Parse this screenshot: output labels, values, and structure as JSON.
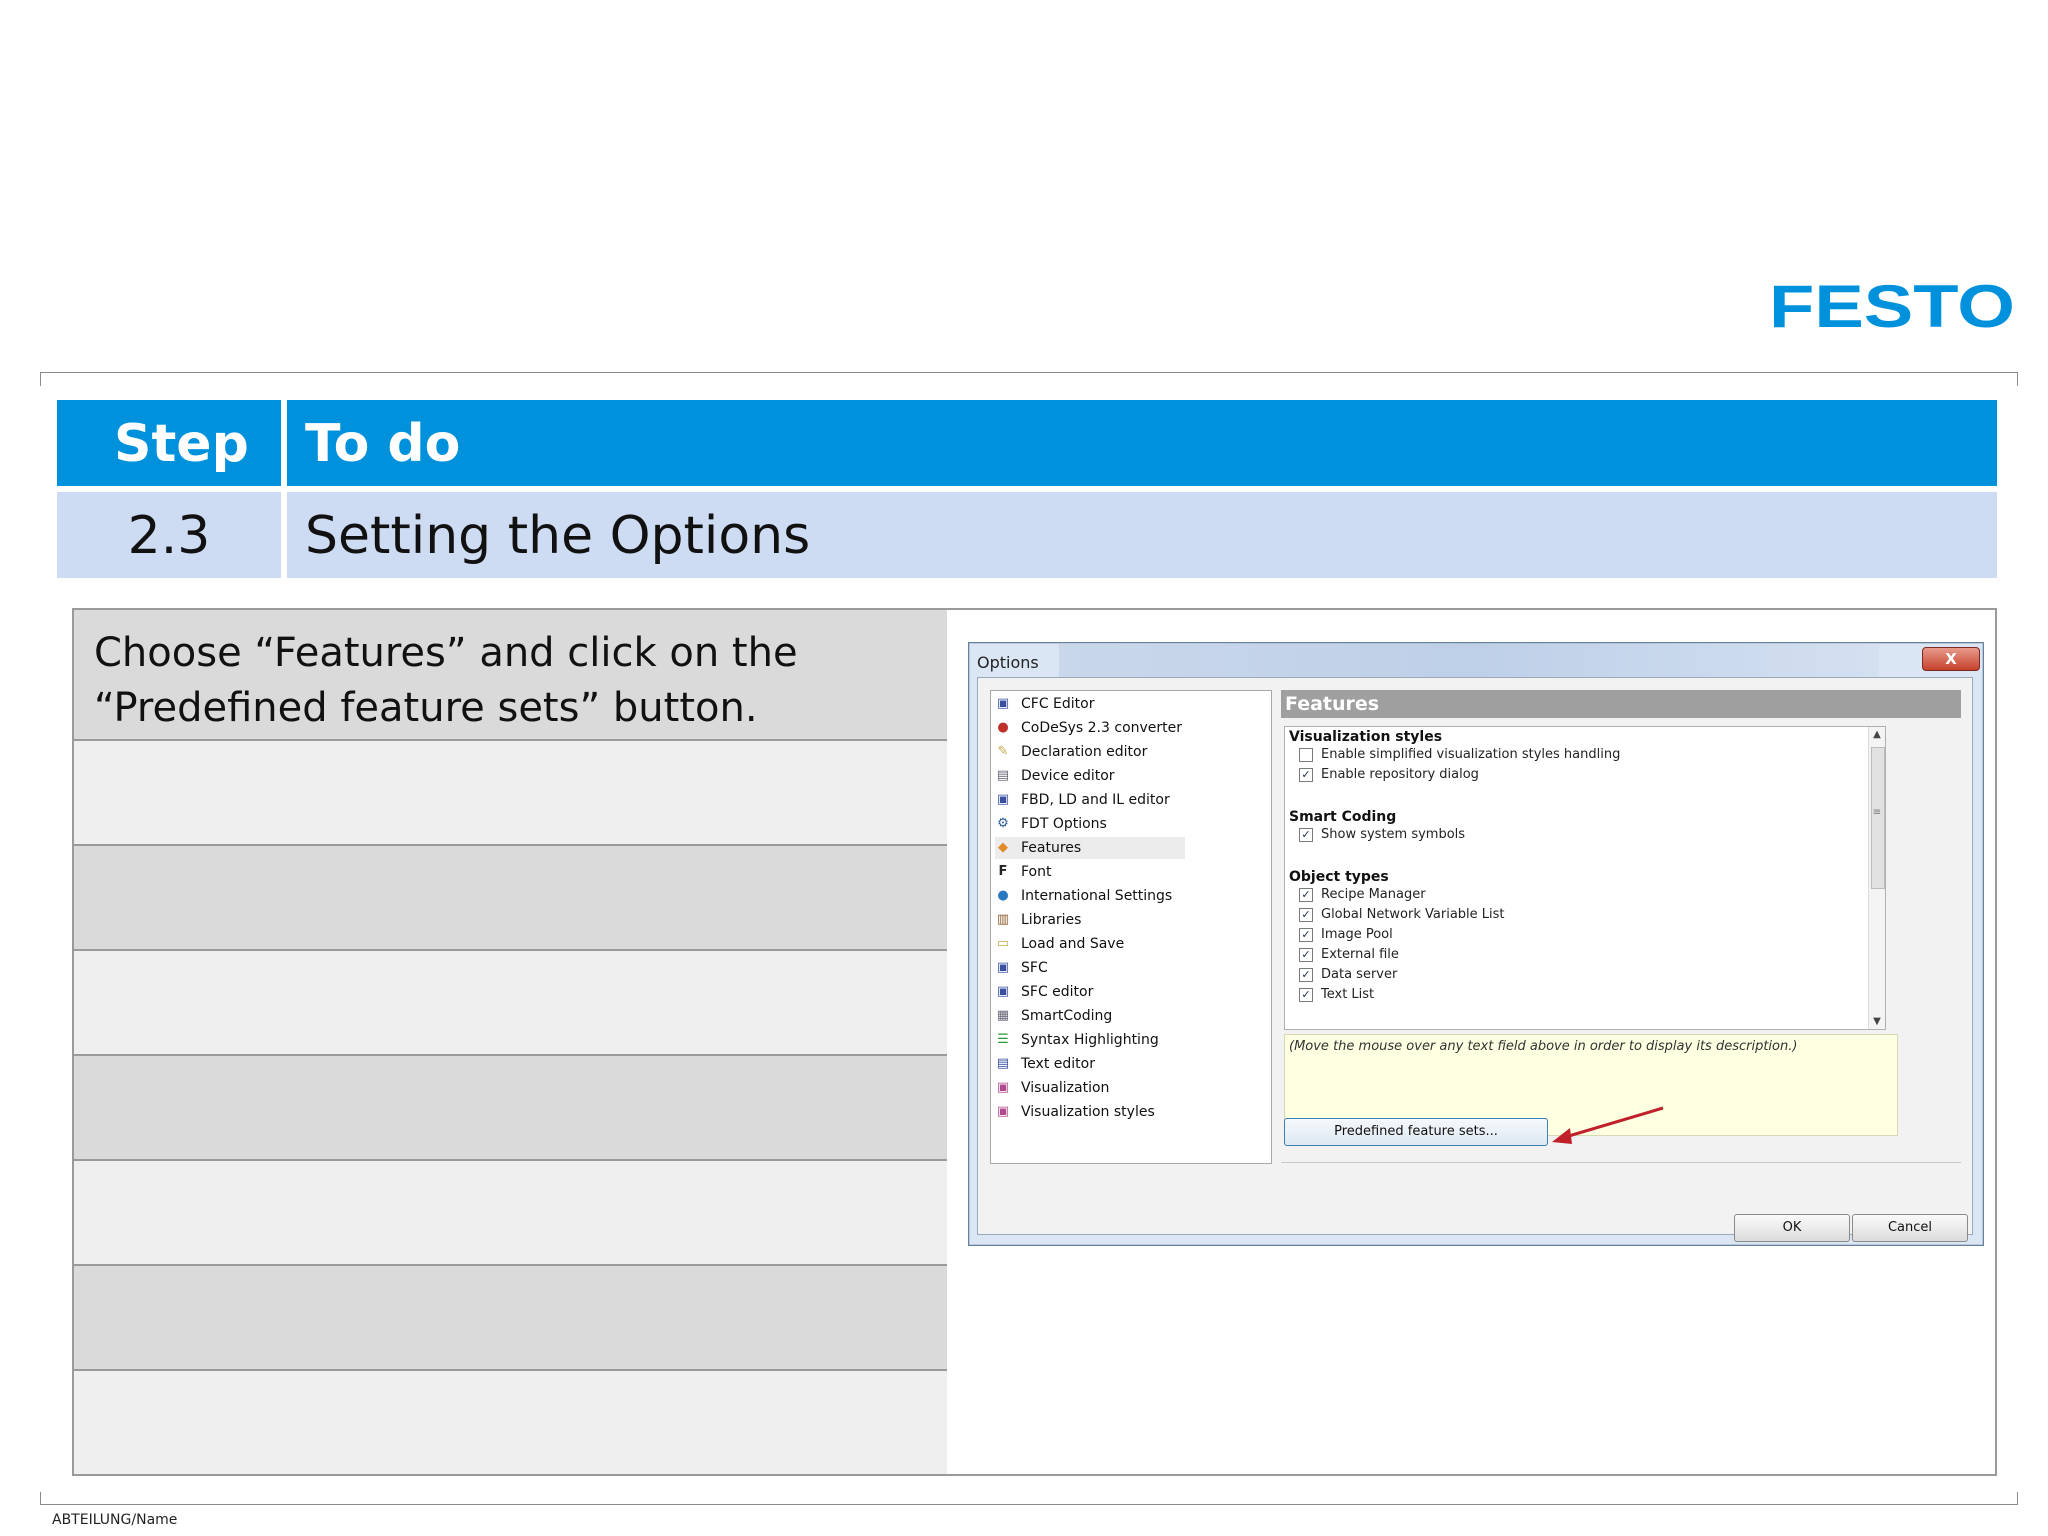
{
  "brand": {
    "logo_text": "FESTO",
    "color": "#0091dc"
  },
  "header": {
    "step_label": "Step",
    "todo_label": "To do"
  },
  "subheader": {
    "step_number": "2.3",
    "title": "Setting the Options"
  },
  "instructions": [
    "Choose “Features” and click on the “Predefined feature sets” button.",
    "",
    "",
    "",
    "",
    "",
    "",
    ""
  ],
  "dialog": {
    "title": "Options",
    "close_label": "X",
    "tree_items": [
      {
        "label": "CFC Editor",
        "icon": "cfc-icon"
      },
      {
        "label": "CoDeSys 2.3 converter",
        "icon": "converter-icon"
      },
      {
        "label": "Declaration editor",
        "icon": "declaration-icon"
      },
      {
        "label": "Device editor",
        "icon": "device-icon"
      },
      {
        "label": "FBD, LD and IL editor",
        "icon": "fbd-icon"
      },
      {
        "label": "FDT Options",
        "icon": "fdt-icon"
      },
      {
        "label": "Features",
        "icon": "features-icon"
      },
      {
        "label": "Font",
        "icon": "font-icon"
      },
      {
        "label": "International Settings",
        "icon": "globe-icon"
      },
      {
        "label": "Libraries",
        "icon": "libraries-icon"
      },
      {
        "label": "Load and Save",
        "icon": "folder-icon"
      },
      {
        "label": "SFC",
        "icon": "sfc-icon"
      },
      {
        "label": "SFC editor",
        "icon": "sfc-editor-icon"
      },
      {
        "label": "SmartCoding",
        "icon": "smartcoding-icon"
      },
      {
        "label": "Syntax Highlighting",
        "icon": "syntax-icon"
      },
      {
        "label": "Text editor",
        "icon": "text-editor-icon"
      },
      {
        "label": "Visualization",
        "icon": "visualization-icon"
      },
      {
        "label": "Visualization styles",
        "icon": "visualization-styles-icon"
      }
    ],
    "selected_item": "Features",
    "panel_title": "Features",
    "sections": {
      "vis_styles": {
        "title": "Visualization styles",
        "opt1": {
          "label": "Enable simplified visualization styles handling",
          "checked": false
        },
        "opt2": {
          "label": "Enable repository dialog",
          "checked": true
        }
      },
      "smart_coding": {
        "title": "Smart Coding",
        "opt1": {
          "label": "Show system symbols",
          "checked": true
        }
      },
      "object_types": {
        "title": "Object types",
        "opt1": {
          "label": "Recipe Manager",
          "checked": true
        },
        "opt2": {
          "label": "Global Network Variable List",
          "checked": true
        },
        "opt3": {
          "label": "Image Pool",
          "checked": true
        },
        "opt4": {
          "label": "External file",
          "checked": true
        },
        "opt5": {
          "label": "Data server",
          "checked": true
        },
        "opt6": {
          "label": "Text List",
          "checked": true
        }
      }
    },
    "description": "(Move the mouse over any text field above in order to display its description.)",
    "predefined_button": "Predefined feature sets...",
    "ok_button": "OK",
    "cancel_button": "Cancel"
  },
  "footer": {
    "text": "ABTEILUNG/Name"
  }
}
